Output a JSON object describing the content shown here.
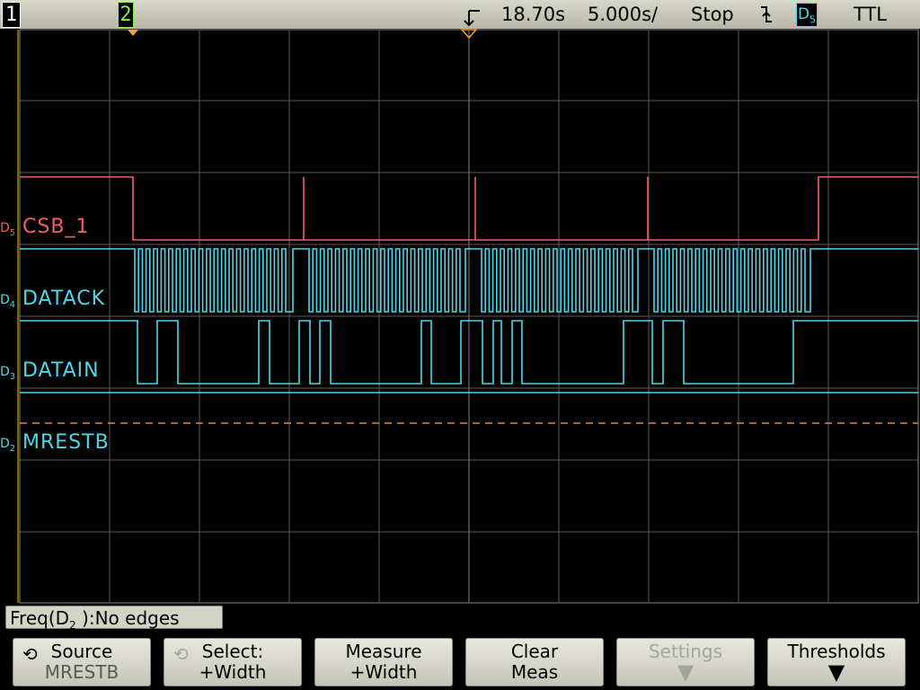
{
  "status": {
    "ch1": "1",
    "ch2": "2",
    "time_ref": "18.70s",
    "timebase": "5.000s/",
    "run_state": "Stop",
    "trigger_edge_icon": "falling-edge-icon",
    "trigger_source": "D",
    "trigger_source_sub": "5",
    "trigger_level": "TTL"
  },
  "channels": [
    {
      "id": "D",
      "sub": "5",
      "name": "CSB_1",
      "color": "#f06060"
    },
    {
      "id": "D",
      "sub": "4",
      "name": "DATACK",
      "color": "#4bd8e8"
    },
    {
      "id": "D",
      "sub": "3",
      "name": "DATAIN",
      "color": "#4bd8e8"
    },
    {
      "id": "D",
      "sub": "2",
      "name": "MRESTB",
      "color": "#4bd8e8"
    }
  ],
  "measurement": {
    "prefix": "Freq(D",
    "sub": "2",
    "suffix": " ):No edges"
  },
  "softkeys": [
    {
      "line1": "Source",
      "line2": "MRESTB"
    },
    {
      "line1": "Select:",
      "line2": "+Width"
    },
    {
      "line1": "Measure",
      "line2": "+Width"
    },
    {
      "line1": "Clear",
      "line2": "Meas"
    },
    {
      "line1": "Settings"
    },
    {
      "line1": "Thresholds"
    }
  ],
  "colors": {
    "grid": "#5a5a5a",
    "trace_red": "#f06060",
    "trace_cyan": "#4bd8e8",
    "marker_orange": "#f0a040",
    "threshold_dash": "#f08040"
  }
}
